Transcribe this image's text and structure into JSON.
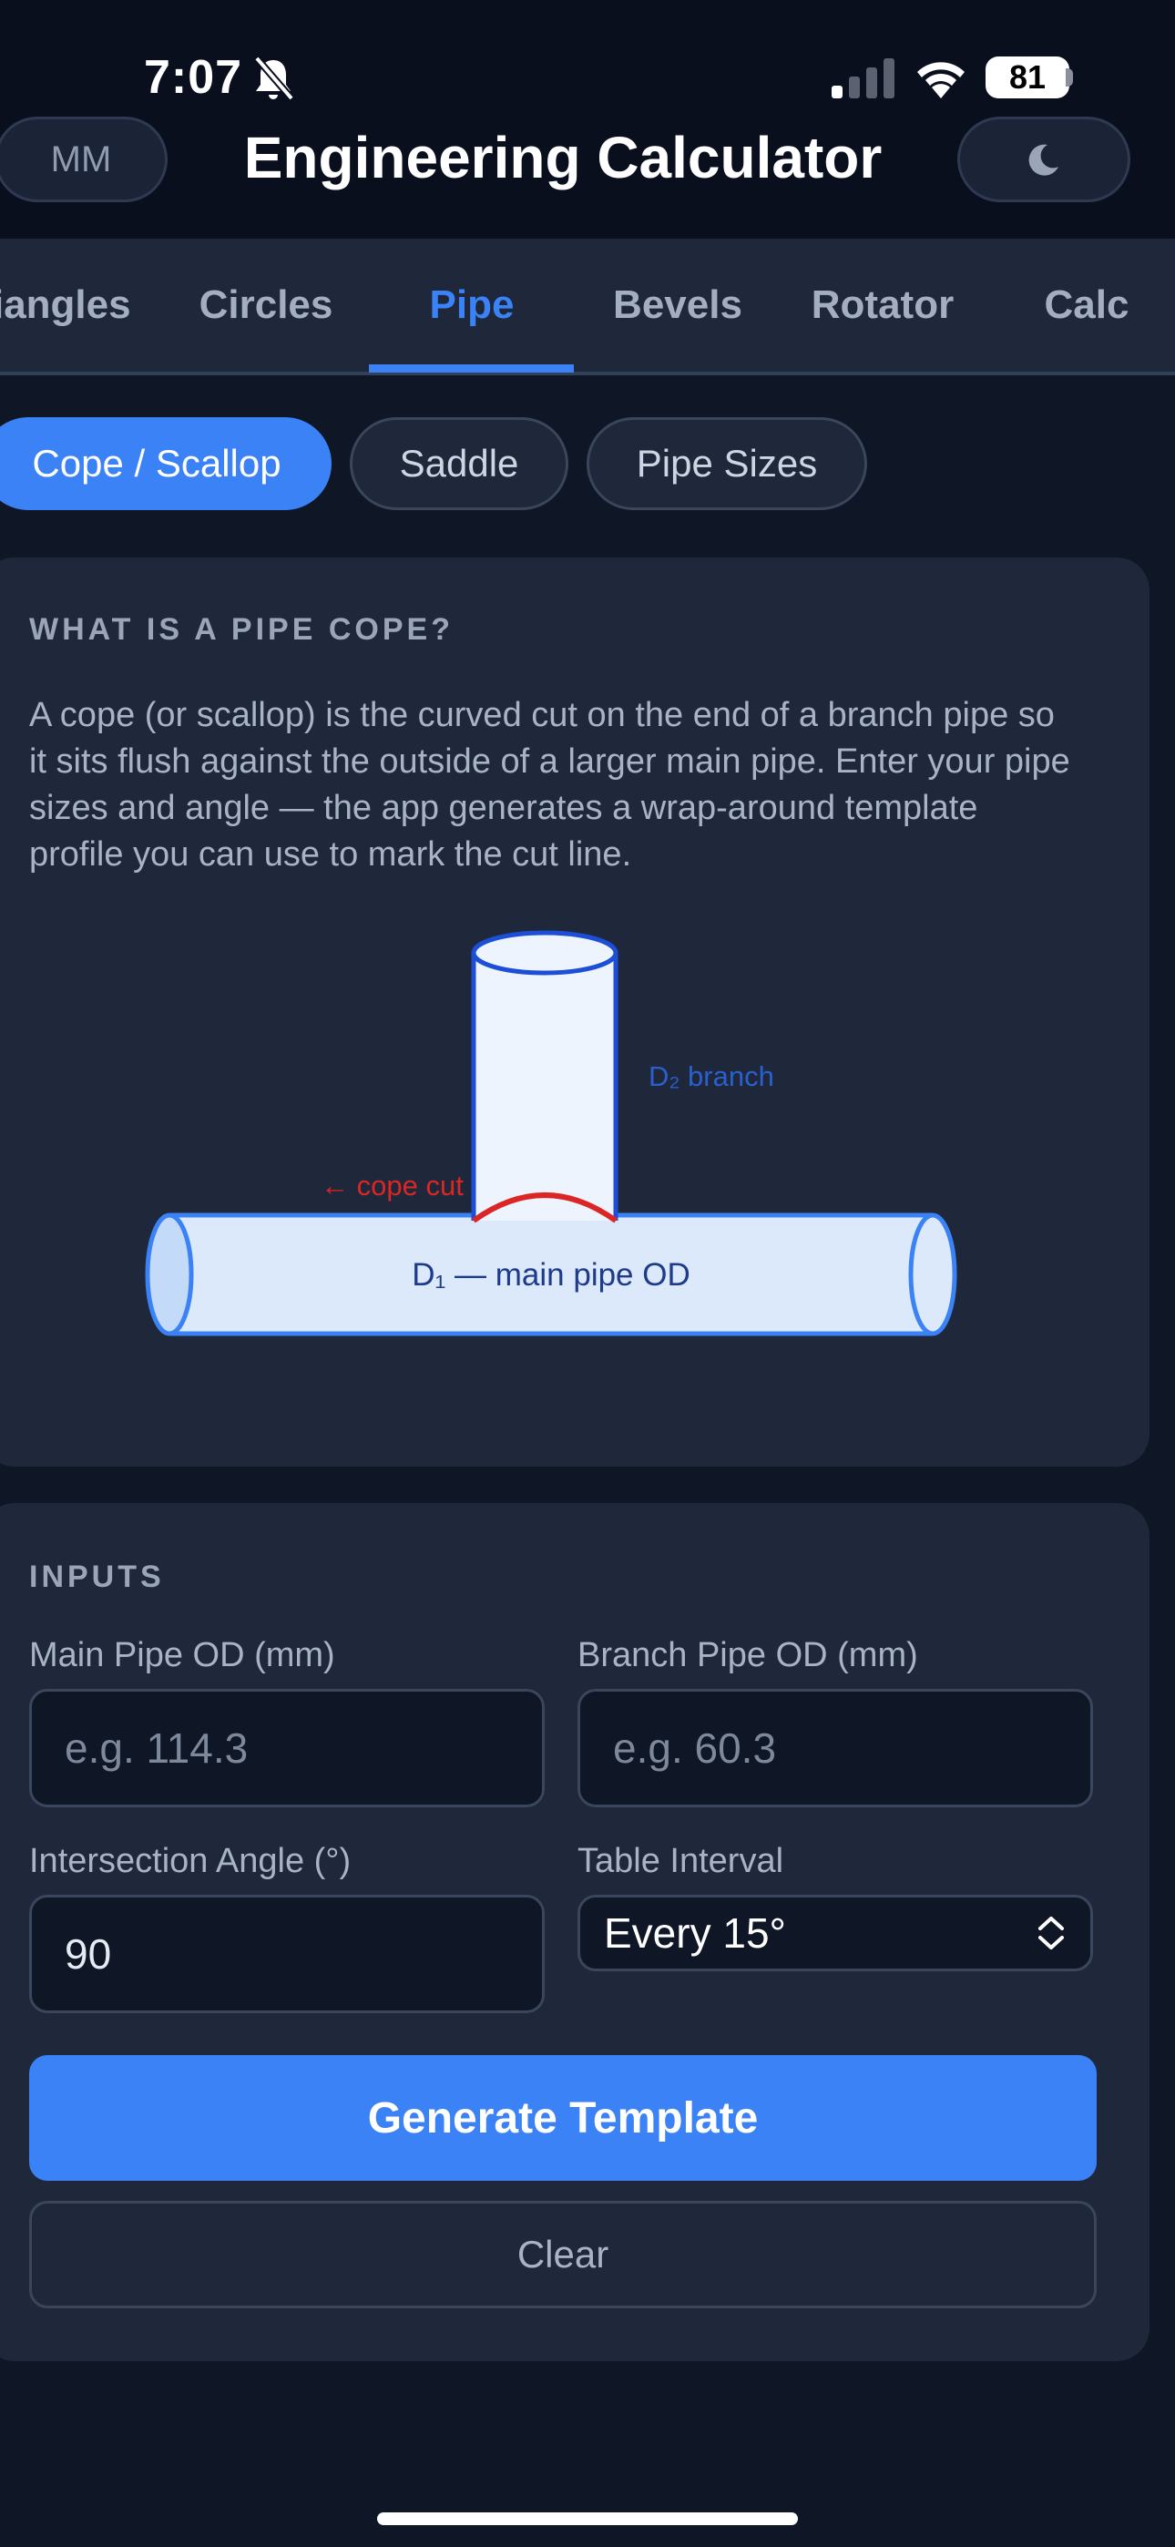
{
  "status_bar": {
    "time": "7:07",
    "battery": "81"
  },
  "header": {
    "unit_button": "MM",
    "title": "Engineering Calculator",
    "theme_icon": "moon-icon"
  },
  "tabs": [
    {
      "label": "Triangles",
      "active": false
    },
    {
      "label": "Circles",
      "active": false
    },
    {
      "label": "Pipe",
      "active": true
    },
    {
      "label": "Bevels",
      "active": false
    },
    {
      "label": "Rotator",
      "active": false
    },
    {
      "label": "Calc",
      "active": false
    }
  ],
  "subtabs": [
    {
      "label": "Cope / Scallop",
      "active": true
    },
    {
      "label": "Saddle",
      "active": false
    },
    {
      "label": "Pipe Sizes",
      "active": false
    }
  ],
  "info": {
    "heading": "WHAT IS A PIPE COPE?",
    "description": "A cope (or scallop) is the curved cut on the end of a branch pipe so it sits flush against the outside of a larger main pipe. Enter your pipe sizes and angle — the app generates a wrap-around template profile you can use to mark the cut line.",
    "diagram": {
      "branch_label": "D₂ branch",
      "cope_label": "← cope cut",
      "main_label": "D₁ — main pipe OD"
    }
  },
  "inputs": {
    "heading": "INPUTS",
    "main_od": {
      "label": "Main Pipe OD (mm)",
      "value": "",
      "placeholder": "e.g. 114.3"
    },
    "branch_od": {
      "label": "Branch Pipe OD (mm)",
      "value": "",
      "placeholder": "e.g. 60.3"
    },
    "angle": {
      "label": "Intersection Angle (°)",
      "value": "90"
    },
    "interval": {
      "label": "Table Interval",
      "value": "Every 15°"
    },
    "generate_label": "Generate Template",
    "clear_label": "Clear"
  },
  "colors": {
    "accent": "#3b82f6",
    "background": "#0f1626",
    "card": "#1e283a",
    "cope_cut": "#dc2626"
  }
}
